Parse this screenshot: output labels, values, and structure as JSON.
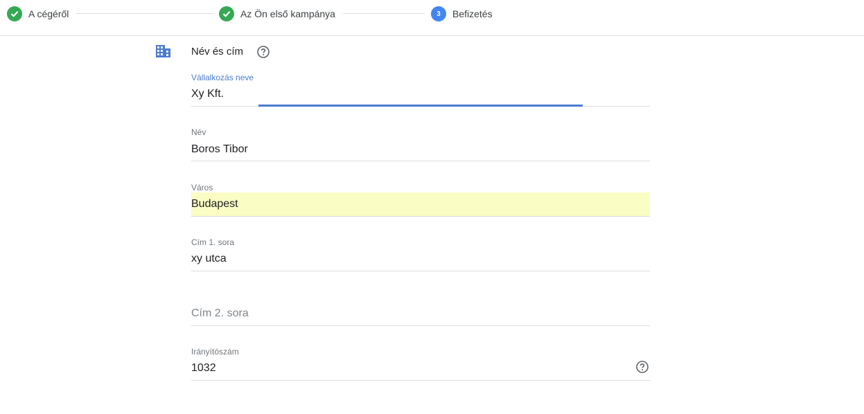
{
  "stepper": {
    "steps": [
      {
        "label": "A cégéről",
        "state": "done"
      },
      {
        "label": "Az Ön első kampánya",
        "state": "done"
      },
      {
        "label": "Befizetés",
        "state": "active",
        "number": "3"
      }
    ]
  },
  "section": {
    "icon": "building-icon",
    "title": "Név és cím"
  },
  "fields": {
    "business_name": {
      "label": "Vállalkozás neve",
      "value": "Xy Kft."
    },
    "name": {
      "label": "Név",
      "value": "Boros Tibor"
    },
    "city": {
      "label": "Város",
      "value": "Budapest"
    },
    "address1": {
      "label": "Cím 1. sora",
      "value": "xy utca"
    },
    "address2": {
      "placeholder": "Cím 2. sora"
    },
    "postal_code": {
      "label": "Irányítószám",
      "value": "1032"
    }
  },
  "colors": {
    "done": "#34a853",
    "active": "#4285f4",
    "focus": "#4a7bd0",
    "autofill": "#fafdc4"
  }
}
